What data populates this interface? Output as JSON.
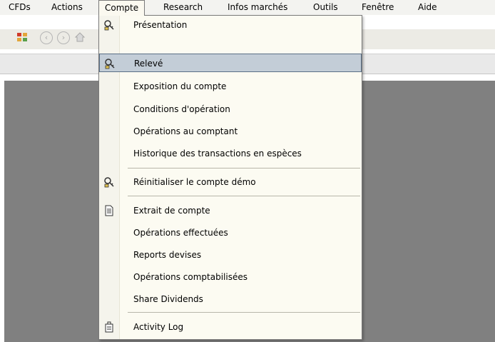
{
  "menubar": {
    "items": [
      "CFDs",
      "Actions",
      "Compte",
      "Research",
      "Infos marchés",
      "Outils",
      "Fenêtre",
      "Aide"
    ]
  },
  "toolbar": {
    "icons": [
      "app-status-icon",
      "back-arrow-icon",
      "forward-arrow-icon",
      "home-icon"
    ]
  },
  "dropdown": {
    "items": [
      {
        "label": "Présentation",
        "icon": "account-keys-icon"
      },
      {
        "label": "Relevé",
        "icon": "account-keys-icon",
        "highlighted": true
      },
      {
        "label": "Exposition du compte"
      },
      {
        "label": "Conditions d'opération"
      },
      {
        "label": "Opérations au comptant"
      },
      {
        "label": "Historique des transactions en espèces"
      },
      {
        "label": "Réinitialiser le compte démo",
        "icon": "account-keys-icon"
      },
      {
        "label": "Extrait de compte",
        "icon": "document-icon"
      },
      {
        "label": "Opérations effectuées"
      },
      {
        "label": "Reports devises"
      },
      {
        "label": "Opérations comptabilisées"
      },
      {
        "label": "Share Dividends"
      },
      {
        "label": "Activity Log",
        "icon": "log-icon"
      }
    ]
  },
  "colors": {
    "menu_bg": "#fcfbf2",
    "highlight": "#c3cdd7",
    "workspace": "#808080"
  }
}
